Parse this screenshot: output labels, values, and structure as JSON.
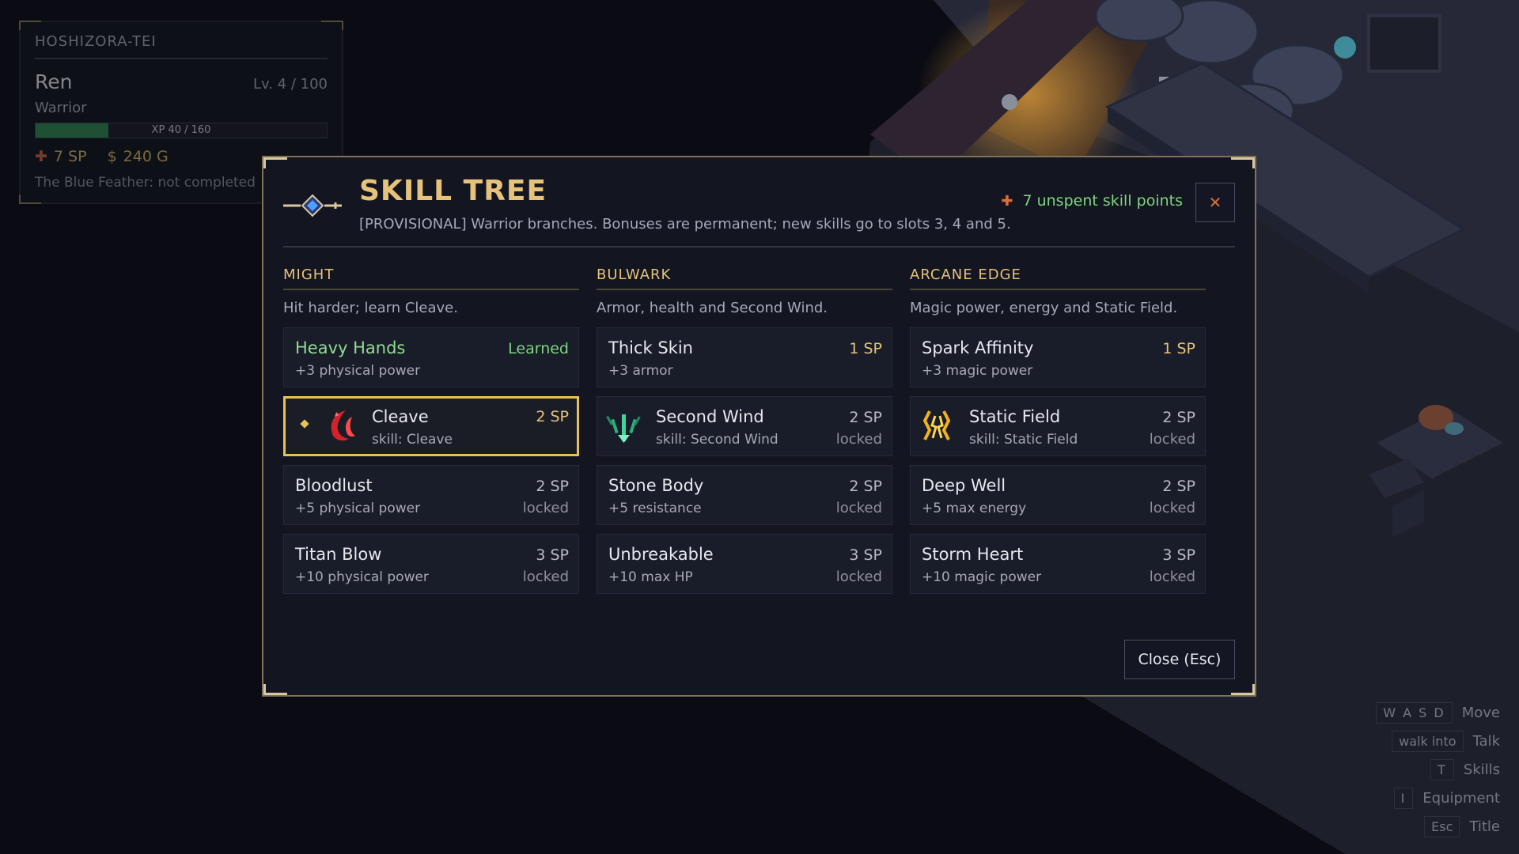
{
  "hud": {
    "inn": "HOSHIZORA-TEI",
    "name": "Ren",
    "level": "Lv. 4 / 100",
    "class": "Warrior",
    "xp_text": "XP 40 / 160",
    "xp_fraction": 0.25,
    "sp": "7 SP",
    "gold": "240 G",
    "quest": "The Blue Feather: not completed"
  },
  "modal": {
    "title": "SKILL TREE",
    "subtitle": "[PROVISIONAL] Warrior branches. Bonuses are permanent; new skills go to slots 3, 4 and 5.",
    "points": "7 unspent skill points",
    "close_x": "✕",
    "close_button": "Close (Esc)",
    "branches": [
      {
        "title": "MIGHT",
        "desc": "Hit harder; learn Cleave.",
        "nodes": [
          {
            "name": "Heavy Hands",
            "effect": "+3 physical power",
            "status": "Learned"
          },
          {
            "name": "Cleave",
            "effect": "skill: Cleave",
            "cost": "2 SP",
            "icon": "cleave-icon"
          },
          {
            "name": "Bloodlust",
            "effect": "+5 physical power",
            "cost": "2 SP",
            "state": "locked"
          },
          {
            "name": "Titan Blow",
            "effect": "+10 physical power",
            "cost": "3 SP",
            "state": "locked"
          }
        ]
      },
      {
        "title": "BULWARK",
        "desc": "Armor, health and Second Wind.",
        "nodes": [
          {
            "name": "Thick Skin",
            "effect": "+3 armor",
            "cost": "1 SP"
          },
          {
            "name": "Second Wind",
            "effect": "skill: Second Wind",
            "cost": "2 SP",
            "state": "locked",
            "icon": "second-wind-icon"
          },
          {
            "name": "Stone Body",
            "effect": "+5 resistance",
            "cost": "2 SP",
            "state": "locked"
          },
          {
            "name": "Unbreakable",
            "effect": "+10 max HP",
            "cost": "3 SP",
            "state": "locked"
          }
        ]
      },
      {
        "title": "ARCANE EDGE",
        "desc": "Magic power, energy and Static Field.",
        "nodes": [
          {
            "name": "Spark Affinity",
            "effect": "+3 magic power",
            "cost": "1 SP"
          },
          {
            "name": "Static Field",
            "effect": "skill: Static Field",
            "cost": "2 SP",
            "state": "locked",
            "icon": "static-field-icon"
          },
          {
            "name": "Deep Well",
            "effect": "+5 max energy",
            "cost": "2 SP",
            "state": "locked"
          },
          {
            "name": "Storm Heart",
            "effect": "+10 magic power",
            "cost": "3 SP",
            "state": "locked"
          }
        ]
      }
    ]
  },
  "hints": [
    {
      "key": "W A S D",
      "label": "Move"
    },
    {
      "key": "walk into",
      "label": "Talk"
    },
    {
      "key": "T",
      "label": "Skills"
    },
    {
      "key": "I",
      "label": "Equipment"
    },
    {
      "key": "Esc",
      "label": "Title"
    }
  ],
  "colors": {
    "accent_gold": "#e6c27a",
    "learned_green": "#7fd67f",
    "selected_border": "#e9c15a",
    "sp_plus": "#d9703a"
  }
}
